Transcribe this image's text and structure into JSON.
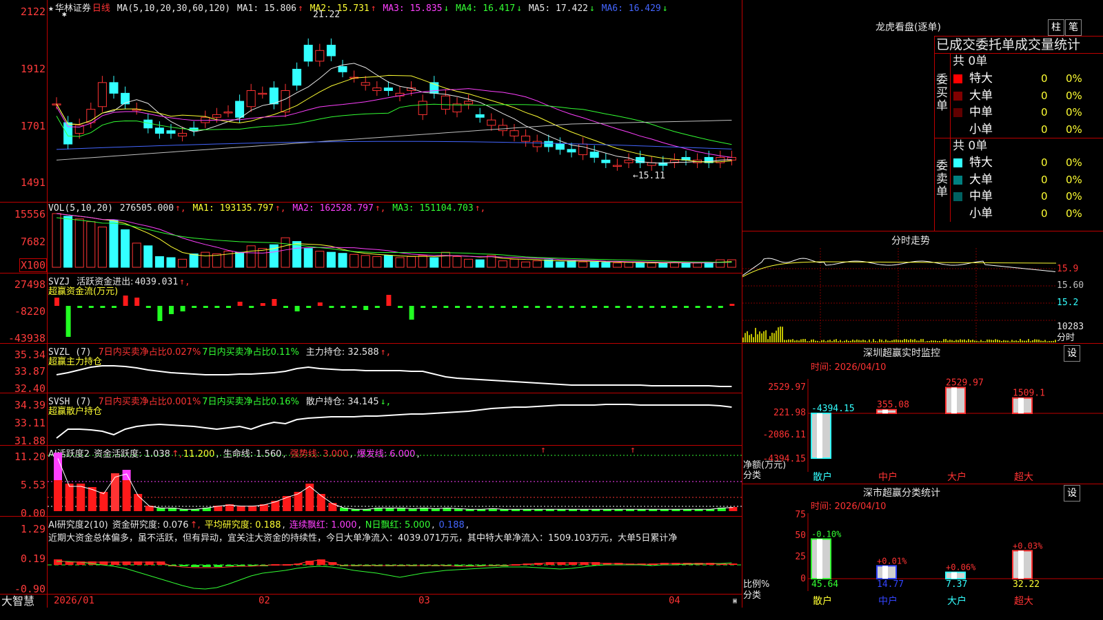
{
  "chart_main": {
    "stock": "华林证券",
    "period": "日线",
    "ma_label": "MA(5,10,20,30,60,120)",
    "ma_values": [
      {
        "name": "MA1",
        "value": "15.806",
        "arrow": "↑",
        "color": "#e8e8e8"
      },
      {
        "name": "MA2",
        "value": "15.731",
        "arrow": "↑",
        "color": "#ffff33"
      },
      {
        "name": "MA3",
        "value": "15.835",
        "arrow": "↓",
        "color": "#ff40ff"
      },
      {
        "name": "MA4",
        "value": "16.417",
        "arrow": "↓",
        "color": "#33ff33"
      },
      {
        "name": "MA5",
        "value": "17.422",
        "arrow": "↓",
        "color": "#e8e8e8"
      },
      {
        "name": "MA6",
        "value": "16.429",
        "arrow": "↓",
        "color": "#4466ff"
      }
    ],
    "y_ticks": [
      "2122",
      "1912",
      "1701",
      "1491"
    ],
    "high_label": "21.22",
    "low_label": "←15.11",
    "x_labels": [
      "2026/01",
      "02",
      "03",
      "04"
    ]
  },
  "chart_vol": {
    "header": "VOL(5,10,20)",
    "value": "276505.000",
    "ma": [
      {
        "name": "MA1",
        "value": "193135.797",
        "color": "#ffff33"
      },
      {
        "name": "MA2",
        "value": "162528.797",
        "color": "#ff40ff"
      },
      {
        "name": "MA3",
        "value": "151104.703",
        "color": "#33ff33"
      }
    ],
    "y_ticks": [
      "15556",
      "7682"
    ],
    "unit": "X100"
  },
  "chart_svzj": {
    "header": "SVZJ",
    "label": "活跃资金进出:",
    "value": "4039.031",
    "subtitle": "超赢资金流(万元)",
    "y_ticks": [
      "27498",
      "-8220",
      "-43938"
    ]
  },
  "chart_svzl": {
    "header": "SVZL (7)",
    "t1": "7日内买卖净占比0.027%",
    "t2": "7日内买卖净占比0.11%",
    "t3": "主力持仓: 32.588",
    "subtitle": "超赢主力持仓",
    "y_ticks": [
      "35.34",
      "33.87",
      "32.40"
    ]
  },
  "chart_svsh": {
    "header": "SVSH (7)",
    "t1": "7日内买卖净占比0.001%",
    "t2": "7日内买卖净占比0.16%",
    "t3": "散户持仓: 34.145",
    "subtitle": "超赢散户持仓",
    "y_ticks": [
      "34.39",
      "33.11",
      "31.88"
    ]
  },
  "chart_ai1": {
    "header": "AI活跃度2",
    "t1": "资金活跃度: 1.038",
    "t2": "11.200",
    "t3": "生命线: 1.560",
    "t4": "强势线: 3.000",
    "t5": "爆发线: 6.000",
    "y_ticks": [
      "11.20",
      "5.53",
      "0.00"
    ]
  },
  "chart_ai2": {
    "header": "AI研究度2(10)",
    "t1": "资金研究度: 0.076",
    "t2": "平均研究度: 0.188",
    "t3": "连续飘红: 1.000",
    "t4": "N日飘红: 5.000",
    "t5": "0.188",
    "comment": "近期大资金总体偏多，虽不活跃，但有异动，宜关注大资金的持续性，今日大单净流入：4039.071万元，其中特大单净流入：1509.103万元，大单5日累计净",
    "y_ticks": [
      "1.29",
      "0.19",
      "-0.90"
    ]
  },
  "footer": {
    "brand": "大智慧"
  },
  "panel_lhb": {
    "title": "龙虎看盘(逐单)",
    "btn1": "柱",
    "btn2": "笔",
    "subtitle": "已成交委托单成交量统计",
    "buy_side": "委买单",
    "sell_side": "委卖单",
    "buy_total": "共 0单",
    "sell_total": "共 0单",
    "rows": [
      {
        "label": "特大",
        "count": "0",
        "pct": "0%"
      },
      {
        "label": "大单",
        "count": "0",
        "pct": "0%"
      },
      {
        "label": "中单",
        "count": "0",
        "pct": "0%"
      },
      {
        "label": "小单",
        "count": "0",
        "pct": "0%"
      }
    ],
    "buy_colors": [
      "#ff0000",
      "#800000",
      "#600000",
      "#000000"
    ],
    "sell_colors": [
      "#33ffff",
      "#008080",
      "#006060",
      "#000000"
    ]
  },
  "panel_fs": {
    "title": "分时走势",
    "y1": "15.9",
    "y2": "15.60",
    "y3": "15.2",
    "vol": "10283",
    "vol_label": "分时"
  },
  "panel_sz": {
    "title": "深圳超赢实时监控",
    "btn": "设",
    "date": "时间: 2026/04/10",
    "y_ticks": [
      "2529.97",
      "221.98",
      "-2086.11",
      "-4394.15"
    ],
    "axis_label": "净额(万元)",
    "axis_label2": "分类",
    "chart_data": {
      "type": "bar",
      "categories": [
        "散户",
        "中户",
        "大户",
        "超大"
      ],
      "values": [
        -4394.15,
        355.08,
        2529.97,
        1509.1
      ],
      "labels": [
        "-4394.15",
        "355.08",
        "2529.97",
        "1509.1"
      ],
      "ylim": [
        -4394.15,
        2529.97
      ]
    }
  },
  "panel_cls": {
    "title": "深市超赢分类统计",
    "btn": "设",
    "date": "时间: 2026/04/10",
    "y_ticks": [
      "75",
      "50",
      "25",
      "0"
    ],
    "axis_label": "比例%",
    "axis_label2": "分类",
    "chart_data": {
      "type": "bar",
      "categories": [
        "散户",
        "中户",
        "大户",
        "超大"
      ],
      "values": [
        45.64,
        14.77,
        7.37,
        32.22
      ],
      "changes": [
        "-0.10%",
        "+0.01%",
        "+0.06%",
        "+0.03%"
      ],
      "ylim": [
        0,
        75
      ]
    }
  }
}
